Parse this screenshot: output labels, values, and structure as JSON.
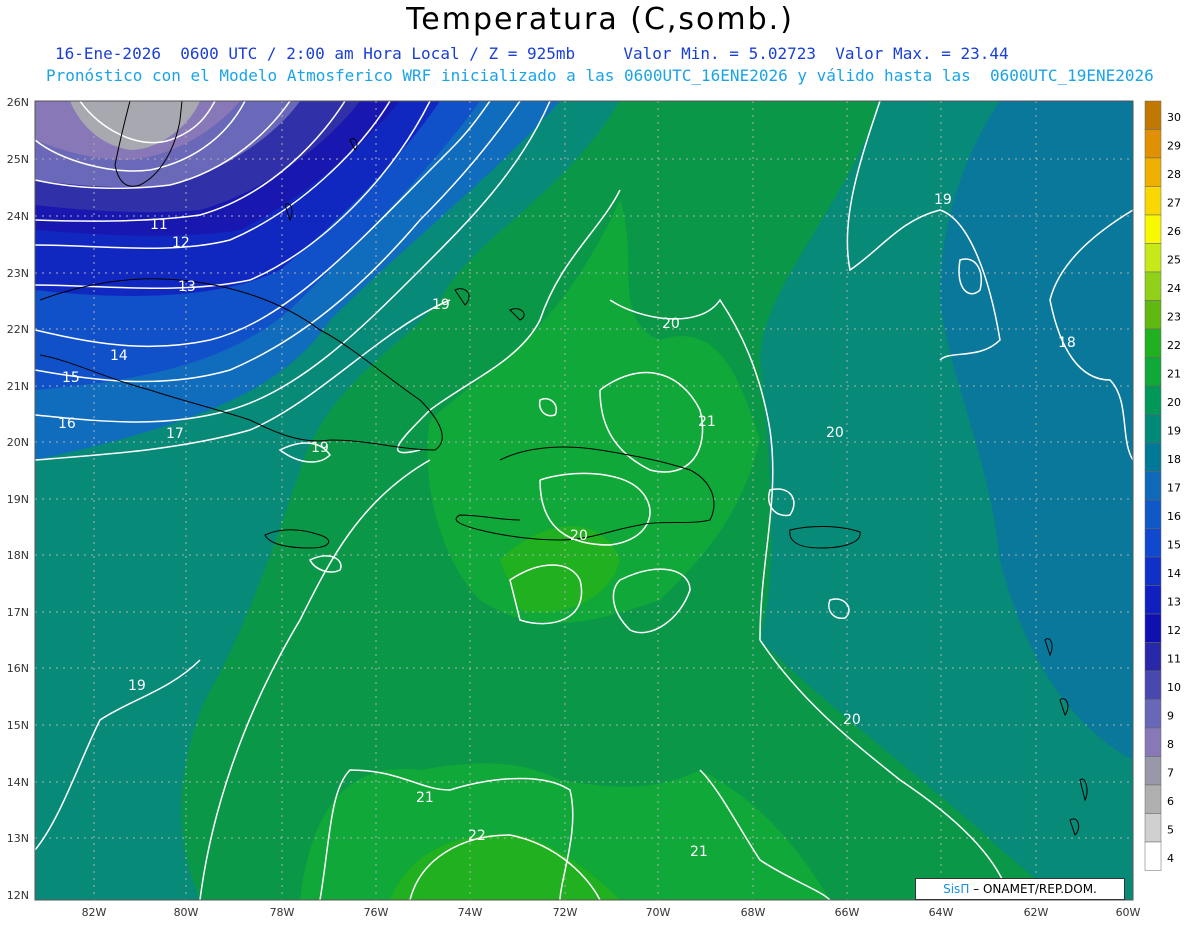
{
  "header": {
    "title": "Temperatura (C,somb.)",
    "line1": "16-Ene-2026  0600 UTC / 2:00 am Hora Local / Z = 925mb     Valor Min. = 5.02723  Valor Max. = 23.44",
    "line2": "Pronóstico con el Modelo Atmosferico WRF inicializado a las 0600UTC_16ENE2026 y válido hasta las  0600UTC_19ENE2026"
  },
  "map": {
    "lat_labels": [
      "26N",
      "25N",
      "24N",
      "23N",
      "22N",
      "21N",
      "20N",
      "19N",
      "18N",
      "17N",
      "16N",
      "15N",
      "14N",
      "13N",
      "12N"
    ],
    "lon_labels": [
      "82W",
      "80W",
      "78W",
      "76W",
      "74W",
      "72W",
      "70W",
      "68W",
      "66W",
      "64W",
      "62W",
      "60W"
    ],
    "contour_labels": [
      {
        "text": "11"
      },
      {
        "text": "12"
      },
      {
        "text": "13"
      },
      {
        "text": "14"
      },
      {
        "text": "15"
      },
      {
        "text": "16"
      },
      {
        "text": "17"
      },
      {
        "text": "19"
      },
      {
        "text": "19"
      },
      {
        "text": "19"
      },
      {
        "text": "20"
      },
      {
        "text": "20"
      },
      {
        "text": "20"
      },
      {
        "text": "20"
      },
      {
        "text": "21"
      },
      {
        "text": "21"
      },
      {
        "text": "21"
      },
      {
        "text": "22"
      },
      {
        "text": "18"
      },
      {
        "text": "19"
      }
    ]
  },
  "colorbar": {
    "labels": [
      "30",
      "29",
      "28",
      "27",
      "26",
      "25",
      "24",
      "23",
      "22",
      "21",
      "20",
      "19",
      "18",
      "17",
      "16",
      "15",
      "14",
      "13",
      "12",
      "11",
      "10",
      "9",
      "8",
      "7",
      "6",
      "5",
      "4"
    ],
    "colors": [
      "#c07800",
      "#e09000",
      "#f0b000",
      "#f8d800",
      "#f8f800",
      "#c8e818",
      "#90d018",
      "#60b810",
      "#20b020",
      "#10a838",
      "#009858",
      "#008878",
      "#007898",
      "#1068b8",
      "#1058c8",
      "#1048d0",
      "#1030c8",
      "#1020c0",
      "#1010b0",
      "#2828a8",
      "#4848b0",
      "#6868b8",
      "#8878b8",
      "#9898a8",
      "#b0b0b0",
      "#d0d0d0",
      "#ffffff"
    ]
  },
  "credit": {
    "sis": "SisΠ",
    "rest": " – ONAMET/REP.DOM."
  }
}
